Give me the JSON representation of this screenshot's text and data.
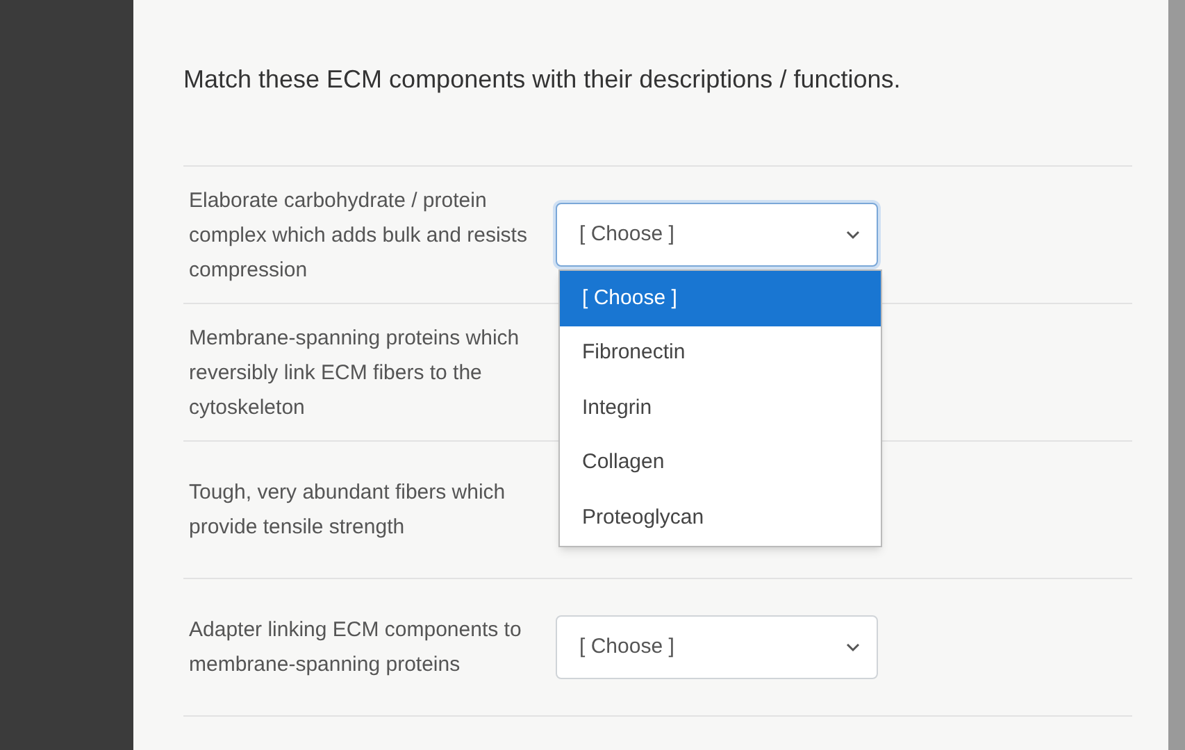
{
  "prompt": "Match these ECM components with their descriptions / functions.",
  "questions": [
    {
      "text": "Elaborate carbohydrate / protein complex which adds bulk and resists compression",
      "select": {
        "value": "[ Choose ]",
        "expanded": true,
        "options": [
          {
            "label": "[ Choose ]",
            "selected": true
          },
          {
            "label": "Fibronectin",
            "selected": false
          },
          {
            "label": "Integrin",
            "selected": false
          },
          {
            "label": "Collagen",
            "selected": false
          },
          {
            "label": "Proteoglycan",
            "selected": false
          }
        ]
      }
    },
    {
      "text": "Membrane-spanning proteins which reversibly link ECM fibers to the cytoskeleton"
    },
    {
      "text": "Tough, very abundant fibers which provide tensile strength"
    },
    {
      "text": "Adapter linking ECM components to membrane-spanning proteins",
      "select": {
        "value": "[ Choose ]",
        "expanded": false
      }
    }
  ]
}
